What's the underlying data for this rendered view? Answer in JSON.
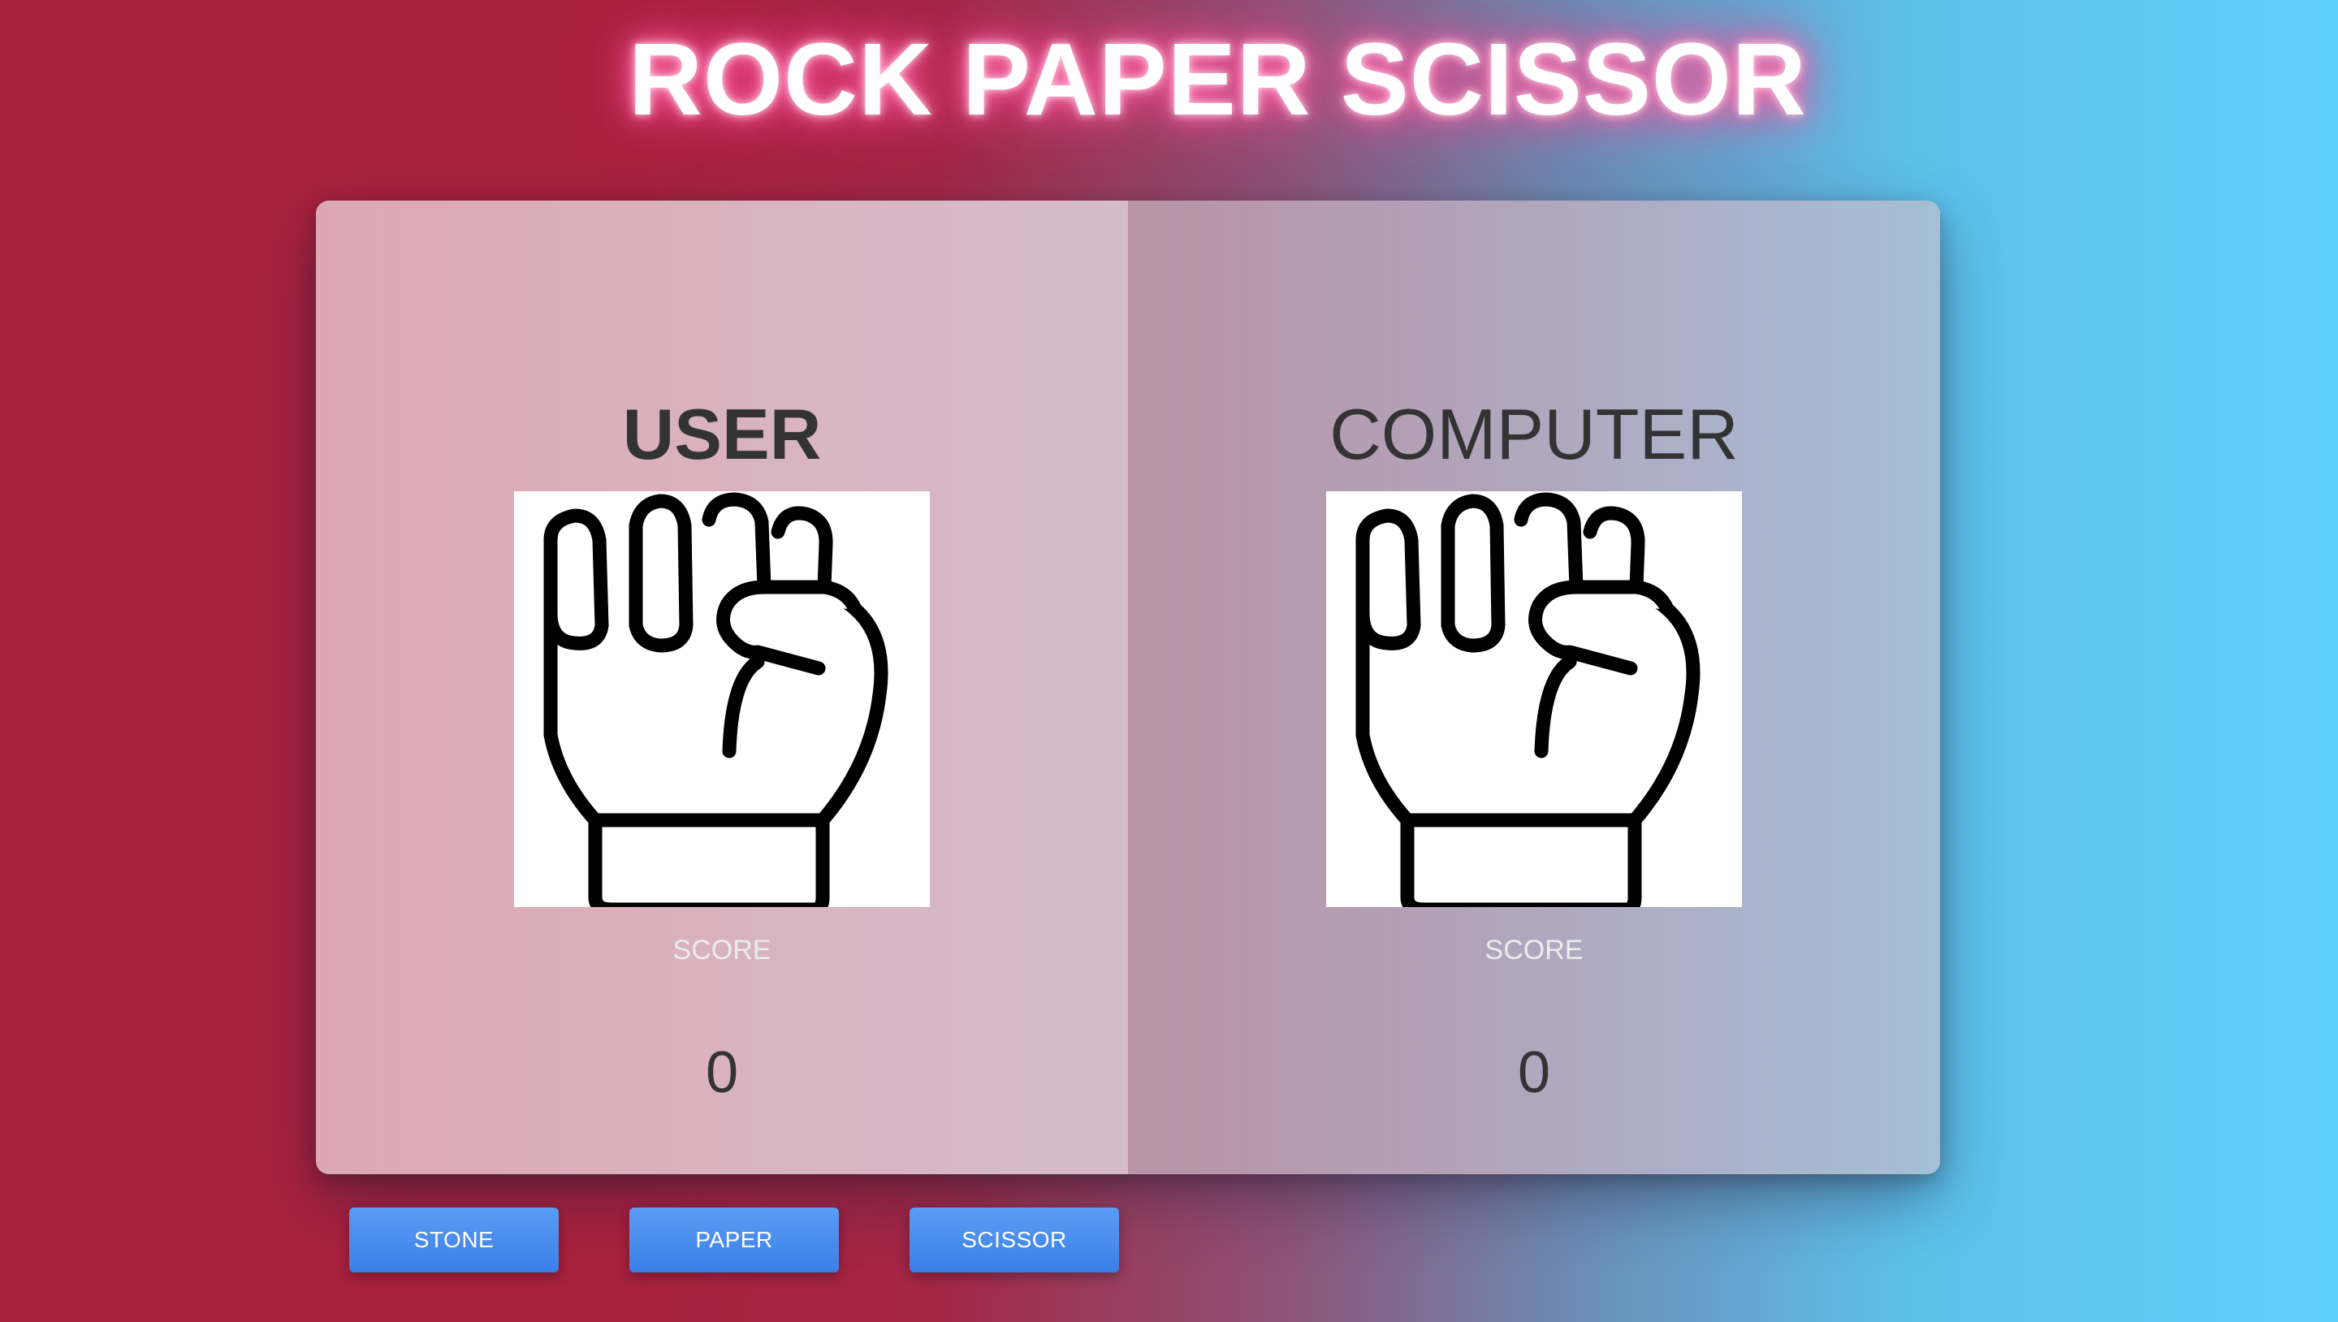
{
  "title": "ROCK PAPER SCISSOR",
  "user": {
    "name": "USER",
    "choice_icon": "rock-fist-icon",
    "score_label": "SCORE",
    "score": "0"
  },
  "computer": {
    "name": "COMPUTER",
    "choice_icon": "rock-fist-icon",
    "score_label": "SCORE",
    "score": "0"
  },
  "buttons": {
    "stone": "STONE",
    "paper": "PAPER",
    "scissor": "SCISSOR"
  },
  "colors": {
    "left_bg": "#a8213e",
    "right_bg": "#5ecffa",
    "button": "#3a7fe6",
    "title_glow": "#ff4f96"
  }
}
